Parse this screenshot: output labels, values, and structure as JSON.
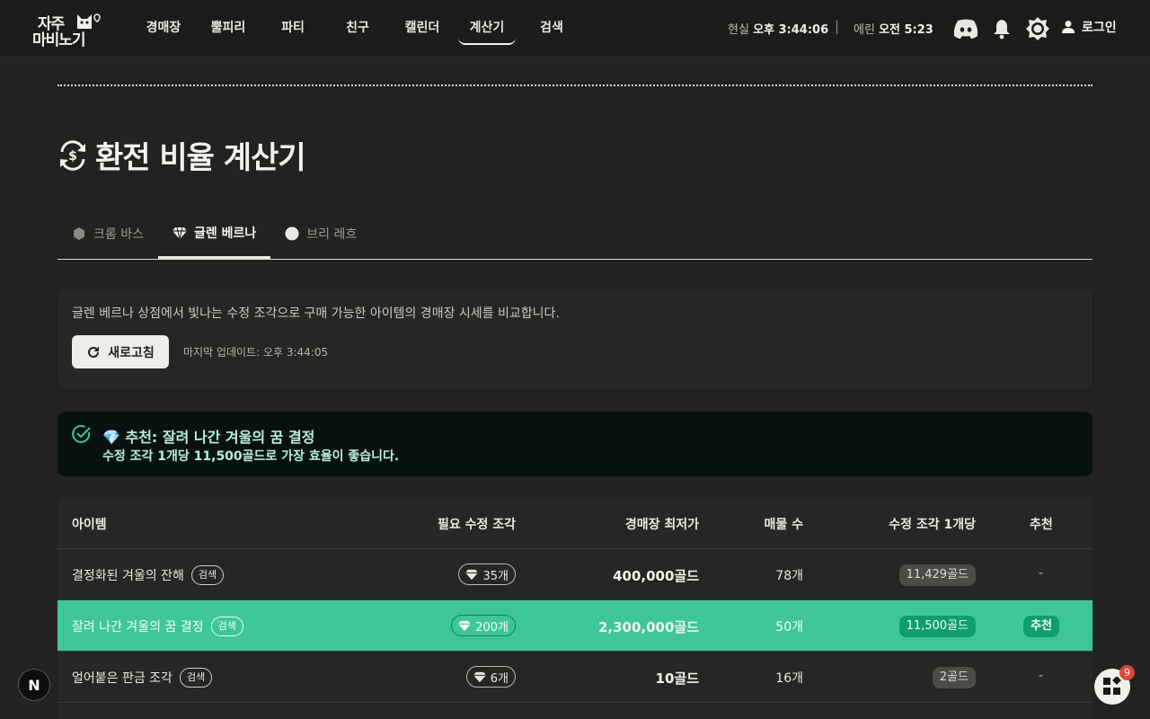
{
  "logo": {
    "line1": "자주",
    "line2": "마비노기"
  },
  "nav": [
    {
      "label": "경매장"
    },
    {
      "label": "뿔피리"
    },
    {
      "label": "파티"
    },
    {
      "label": "친구"
    },
    {
      "label": "캘린더"
    },
    {
      "label": "계산기",
      "active": true
    },
    {
      "label": "검색"
    }
  ],
  "clock": {
    "real_prefix": "현실",
    "real_time": "오후 3:44:06",
    "erin_prefix": "에린",
    "erin_time": "오전 5:23",
    "separator": "|"
  },
  "header_icons": [
    "discord-icon",
    "bell-icon",
    "theme-toggle-icon",
    "user-icon"
  ],
  "login_label": "로그인",
  "page": {
    "title": "환전 비율 계산기",
    "title_icon": "currency-exchange-icon"
  },
  "tabs": [
    {
      "label": "크롬 바스",
      "icon": "hexagon-icon",
      "active": false
    },
    {
      "label": "글렌 베르나",
      "icon": "gem-icon",
      "active": true
    },
    {
      "label": "브리 레흐",
      "icon": "circle-icon",
      "active": false
    }
  ],
  "info": {
    "description": "글렌 베르나 상점에서 빛나는 수정 조각으로 구매 가능한 아이템의 경매장 시세를 비교합니다.",
    "refresh_label": "새로고침",
    "last_update": "마지막 업데이트: 오후 3:44:05"
  },
  "recommend": {
    "title": "💎 추천: 잘려 나간 겨울의 꿈 결정",
    "detail": "수정 조각 1개당 11,500골드로 가장 효율이 좋습니다."
  },
  "table": {
    "headers": {
      "item": "아이템",
      "shards": "필요 수정 조각",
      "lowest": "경매장 최저가",
      "listings": "매물 수",
      "per_shard": "수정 조각 1개당",
      "recommend": "추천"
    },
    "search_label": "검색",
    "rows": [
      {
        "name": "결정화된 겨울의 잔해",
        "shards": "35개",
        "price": "400,000골드",
        "listings": "78개",
        "per_shard": "11,429골드",
        "recommend": "-",
        "highlight": false
      },
      {
        "name": "잘려 나간 겨울의 꿈 결정",
        "shards": "200개",
        "price": "2,300,000골드",
        "listings": "50개",
        "per_shard": "11,500골드",
        "recommend": "추천",
        "highlight": true
      },
      {
        "name": "얼어붙은 판금 조각",
        "shards": "6개",
        "price": "10골드",
        "listings": "16개",
        "per_shard": "2골드",
        "recommend": "-",
        "highlight": false
      },
      {
        "name": "",
        "shards": "",
        "price": "",
        "listings": "",
        "per_shard": "",
        "recommend": "",
        "highlight": false
      }
    ]
  },
  "floating": {
    "next_label": "N",
    "widget_count": "9"
  },
  "colors": {
    "accent": "#3ec69a",
    "accent_dark": "#0f9d6e",
    "background": "#222220"
  }
}
